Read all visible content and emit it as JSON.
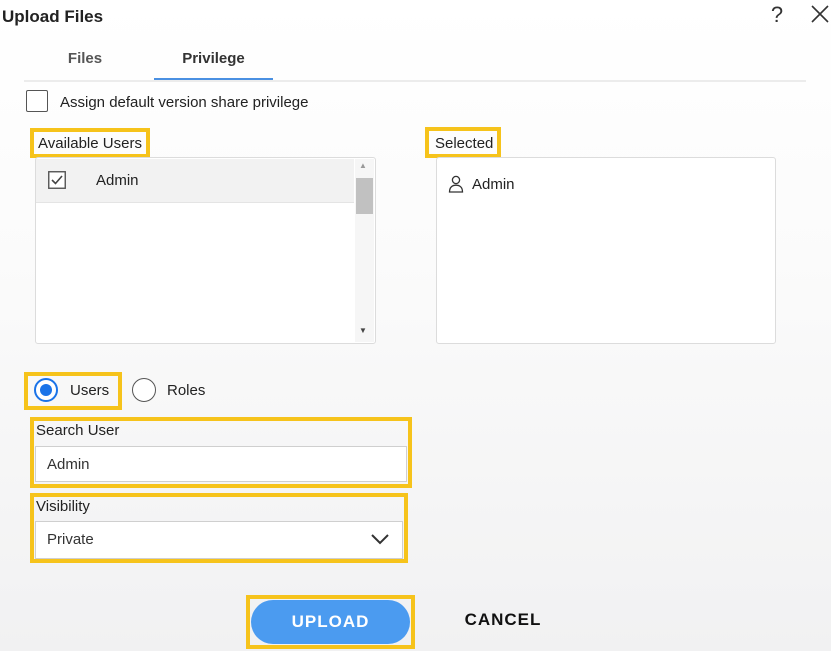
{
  "dialog": {
    "title": "Upload Files",
    "help_glyph": "?",
    "icons": {
      "help": "help-icon",
      "close": "close-icon"
    }
  },
  "tabs": [
    {
      "label": "Files",
      "active": false
    },
    {
      "label": "Privilege",
      "active": true
    }
  ],
  "assign_default": {
    "label": "Assign default version share privilege",
    "checked": false
  },
  "available_users": {
    "label": "Available Users",
    "items": [
      {
        "label": "Admin",
        "checked": true
      }
    ]
  },
  "selected": {
    "label": "Selected",
    "items": [
      {
        "label": "Admin",
        "icon": "user-icon"
      }
    ]
  },
  "mode": {
    "options": [
      {
        "label": "Users",
        "selected": true
      },
      {
        "label": "Roles",
        "selected": false
      }
    ]
  },
  "search_user": {
    "label": "Search User",
    "value": "Admin"
  },
  "visibility": {
    "label": "Visibility",
    "value": "Private"
  },
  "actions": {
    "upload": "UPLOAD",
    "cancel": "CANCEL"
  },
  "colors": {
    "highlight": "#f6c31b",
    "accent": "#1a73e8",
    "upload_bg": "#4b9bf0",
    "tab_underline": "#4a90e2"
  }
}
